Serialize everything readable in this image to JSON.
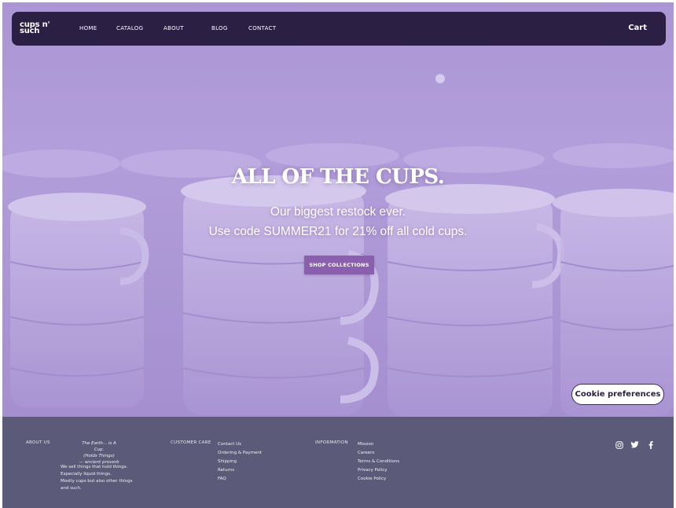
{
  "brand": {
    "logo_line1": "cups n'",
    "logo_line2": "such"
  },
  "nav": {
    "items": [
      {
        "label": "HOME"
      },
      {
        "label": "CATALOG"
      },
      {
        "label": "ABOUT"
      },
      {
        "label": "BLOG"
      },
      {
        "label": "CONTACT"
      }
    ],
    "cart_label": "Cart"
  },
  "hero": {
    "title": "ALL OF THE CUPS.",
    "subtitle_line1": "Our biggest restock ever.",
    "subtitle_line2": "Use code SUMMER21 for 21% off all cold cups.",
    "cta_label": "SHOP COLLECTIONS"
  },
  "cookie": {
    "label": "Cookie preferences"
  },
  "footer": {
    "about": {
      "heading": "ABOUT US",
      "quote_line1": "The Earth... is A Cup.",
      "quote_line2": "(Holds Things)",
      "quote_line3": "— ancient proverb",
      "desc_line1": "We sell things that hold things.",
      "desc_line2": "Especially liquid things.",
      "desc_line3": "Mostly cups but also other things",
      "desc_line4": "and such."
    },
    "care": {
      "heading": "CUSTOMER CARE",
      "links": [
        "Contact Us",
        "Ordering & Payment",
        "Shipping",
        "Returns",
        "FAQ"
      ]
    },
    "info": {
      "heading": "INFORMATION",
      "links": [
        "Mission",
        "Careers",
        "Terms & Conditions",
        "Privacy Policy",
        "Cookie Policy"
      ]
    },
    "socials": [
      "instagram-icon",
      "twitter-icon",
      "facebook-icon"
    ]
  },
  "colors": {
    "navbar": "#2b1f44",
    "hero_overlay": "#b3a0dc",
    "cta": "#8a5fae",
    "footer": "#5b5a78"
  }
}
